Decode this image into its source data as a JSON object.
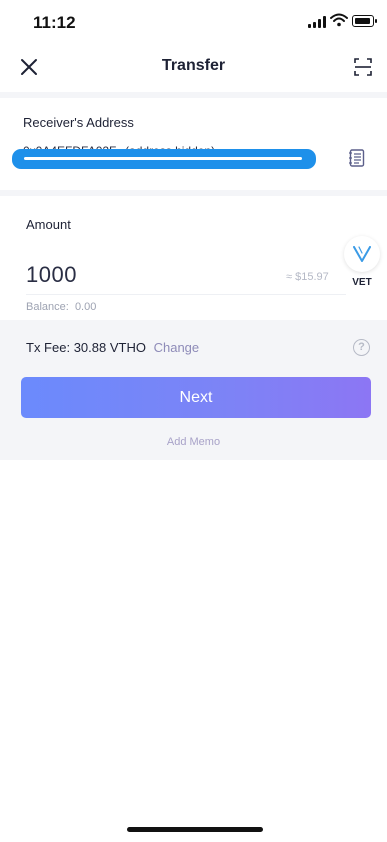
{
  "status_bar": {
    "time": "11:12"
  },
  "nav": {
    "title": "Transfer",
    "close_icon": "close-icon",
    "scan_icon": "scan-icon"
  },
  "receiver": {
    "label": "Receiver's Address",
    "value": "0x0A4EFDFA02F...(address hidden)",
    "book_icon": "address-book-icon"
  },
  "amount": {
    "label": "Amount",
    "value": "1000",
    "fiat": "≈ $15.97",
    "balance_label": "Balance:",
    "balance_value": "0.00",
    "token": "VET"
  },
  "fee": {
    "label": "Tx Fee:",
    "value": "30.88 VTHO",
    "change": "Change"
  },
  "buttons": {
    "next": "Next",
    "add_memo": "Add Memo"
  },
  "colors": {
    "accent": "#6b8afc",
    "accent2": "#8c76f4",
    "mask": "#1e90ea",
    "link": "#8e8bb8"
  }
}
